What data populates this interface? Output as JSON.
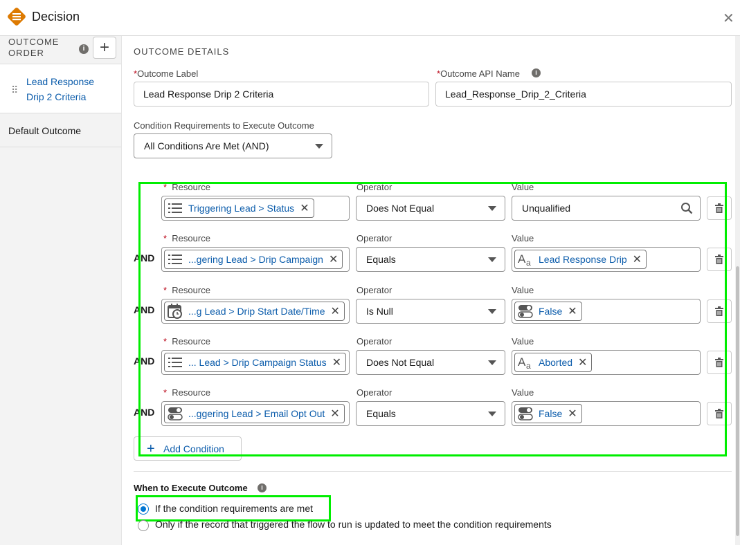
{
  "header": {
    "title": "Decision",
    "close_glyph": "✕"
  },
  "sidebar": {
    "order_label": "OUTCOME ORDER",
    "add_glyph": "+",
    "items": [
      {
        "label": "Lead Response Drip 2 Criteria",
        "selected": true
      },
      {
        "label": "Default Outcome",
        "selected": false
      }
    ]
  },
  "details": {
    "section_title": "OUTCOME DETAILS",
    "outcome_label": {
      "label": "Outcome Label",
      "value": "Lead Response Drip 2 Criteria"
    },
    "api_name": {
      "label": "Outcome API Name",
      "value": "Lead_Response_Drip_2_Criteria"
    },
    "condition_req": {
      "label": "Condition Requirements to Execute Outcome",
      "value": "All Conditions Are Met (AND)"
    }
  },
  "conditions": {
    "resource_label": "Resource",
    "operator_label": "Operator",
    "value_label": "Value",
    "and_label": "AND",
    "rows": [
      {
        "resource": "Triggering Lead > Status",
        "resource_icon": "picklist-icon",
        "operator": "Does Not Equal",
        "value": "Unqualified",
        "value_type": "search"
      },
      {
        "resource": "...gering Lead > Drip Campaign",
        "resource_icon": "picklist-icon",
        "operator": "Equals",
        "value": "Lead Response Drip",
        "value_type": "text-pill"
      },
      {
        "resource": "...g Lead > Drip Start Date/Time",
        "resource_icon": "datetime-icon",
        "operator": "Is Null",
        "value": "False",
        "value_type": "toggle-pill"
      },
      {
        "resource": "... Lead > Drip Campaign Status",
        "resource_icon": "picklist-icon",
        "operator": "Does Not Equal",
        "value": "Aborted",
        "value_type": "text-pill"
      },
      {
        "resource": "...ggering Lead > Email Opt Out",
        "resource_icon": "toggle-icon",
        "operator": "Equals",
        "value": "False",
        "value_type": "toggle-pill"
      }
    ],
    "add_condition": "Add Condition"
  },
  "execute": {
    "title": "When to Execute Outcome",
    "options": [
      {
        "label": "If the condition requirements are met",
        "checked": true
      },
      {
        "label": "Only if the record that triggered the flow to run is updated to meet the condition requirements",
        "checked": false
      }
    ]
  },
  "colors": {
    "accent": "#0176d3",
    "link": "#0b5cab",
    "highlight": "#00ee00",
    "logo": "#dd7a01"
  }
}
